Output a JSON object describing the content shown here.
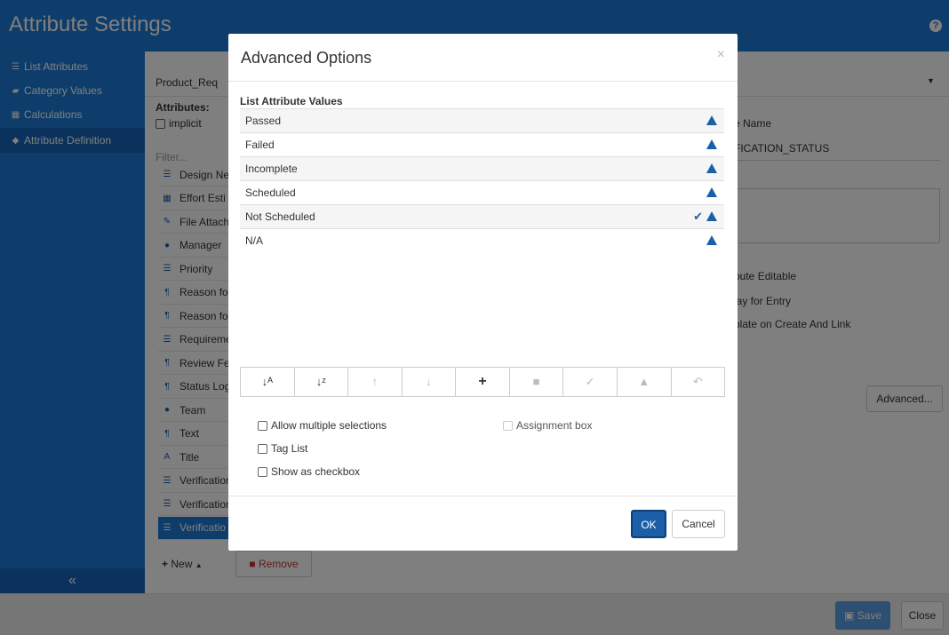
{
  "app": {
    "title": "Attribute Settings",
    "help": "?"
  },
  "sidebar": {
    "items": [
      {
        "label": "List Attributes"
      },
      {
        "label": "Category Values"
      },
      {
        "label": "Calculations"
      },
      {
        "label": "Attribute Definition"
      }
    ],
    "collapse": "«"
  },
  "main": {
    "product": "Product_Req",
    "attributes_label": "Attributes:",
    "implicit_label": "implicit",
    "filter_placeholder": "Filter...",
    "name_label": "e Name",
    "name_value": "FICATION_STATUS",
    "options": [
      "bute Editable",
      "lay for Entry",
      "plate on Create And Link"
    ],
    "advanced_button": "Advanced...",
    "attr_list": [
      {
        "label": "Design Ne",
        "icon": "list-icon"
      },
      {
        "label": "Effort Esti",
        "icon": "calc-icon"
      },
      {
        "label": "File Attach",
        "icon": "paperclip-icon"
      },
      {
        "label": "Manager",
        "icon": "user-icon"
      },
      {
        "label": "Priority",
        "icon": "list-icon"
      },
      {
        "label": "Reason fo",
        "icon": "paragraph-icon"
      },
      {
        "label": "Reason fo",
        "icon": "paragraph-icon"
      },
      {
        "label": "Requireme",
        "icon": "list-icon"
      },
      {
        "label": "Review Fe",
        "icon": "paragraph-icon"
      },
      {
        "label": "Status Log",
        "icon": "paragraph-icon"
      },
      {
        "label": "Team",
        "icon": "user-icon"
      },
      {
        "label": "Text",
        "icon": "paragraph-icon"
      },
      {
        "label": "Title",
        "icon": "font-icon"
      },
      {
        "label": "Verification",
        "icon": "list-icon"
      },
      {
        "label": "Verification",
        "icon": "list-icon"
      },
      {
        "label": "Verificatio",
        "icon": "list-icon"
      }
    ],
    "new_button": "New",
    "remove_button": "Remove"
  },
  "footer": {
    "save": "Save",
    "close": "Close"
  },
  "modal": {
    "title": "Advanced Options",
    "close": "×",
    "section": "List Attribute Values",
    "values": [
      "Passed",
      "Failed",
      "Incomplete",
      "Scheduled",
      "Not Scheduled",
      "N/A"
    ],
    "checked_value": "Not Scheduled",
    "toolbar": [
      "sort-ascending-icon",
      "sort-descending-icon",
      "move-up-icon",
      "move-down-icon",
      "add-icon",
      "delete-icon",
      "check-icon",
      "warning-icon",
      "undo-icon"
    ],
    "checkboxes": {
      "allow_multiple": "Allow multiple selections",
      "assignment_box": "Assignment box",
      "tag_list": "Tag List",
      "show_checkbox": "Show as checkbox"
    },
    "ok": "OK",
    "cancel": "Cancel"
  }
}
